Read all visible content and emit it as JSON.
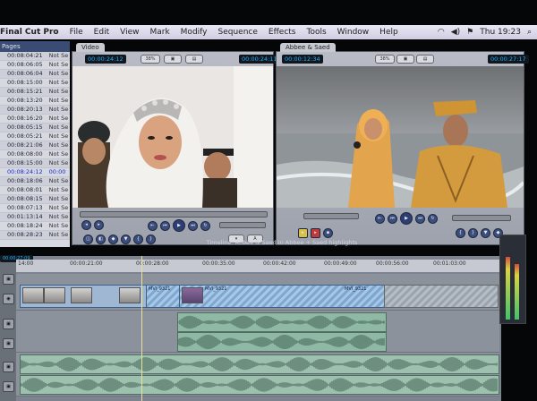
{
  "menubar": {
    "app": "Final Cut Pro",
    "items": [
      "File",
      "Edit",
      "View",
      "Mark",
      "Modify",
      "Sequence",
      "Effects",
      "Tools",
      "Window",
      "Help"
    ],
    "clock": "Thu 19:23"
  },
  "browser": {
    "header": "Pages",
    "rows": [
      {
        "tc": "00:08:04:21",
        "status": "Not Se"
      },
      {
        "tc": "00:08:06:05",
        "status": "Not Se"
      },
      {
        "tc": "00:08:06:04",
        "status": "Not Se"
      },
      {
        "tc": "00:08:15:00",
        "status": "Not Se"
      },
      {
        "tc": "00:08:15:21",
        "status": "Not Se"
      },
      {
        "tc": "00:08:13:20",
        "status": "Not Se"
      },
      {
        "tc": "00:08:20:13",
        "status": "Not Se"
      },
      {
        "tc": "00:08:16:20",
        "status": "Not Se"
      },
      {
        "tc": "00:08:05:15",
        "status": "Not Se"
      },
      {
        "tc": "00:08:05:21",
        "status": "Not Se"
      },
      {
        "tc": "00:08:21:06",
        "status": "Not Se"
      },
      {
        "tc": "00:08:08:00",
        "status": "Not Se"
      },
      {
        "tc": "00:08:15:00",
        "status": "Not Se"
      },
      {
        "tc": "00:08:24:12",
        "status": "00:00",
        "selected": true
      },
      {
        "tc": "00:08:18:06",
        "status": "Not Se"
      },
      {
        "tc": "00:08:08:01",
        "status": "Not Se"
      },
      {
        "tc": "00:08:08:15",
        "status": "Not Se"
      },
      {
        "tc": "00:08:07:13",
        "status": "Not Se"
      },
      {
        "tc": "00:01:13:14",
        "status": "Not Se"
      },
      {
        "tc": "00:08:18:24",
        "status": "Not Se"
      },
      {
        "tc": "00:08:28:23",
        "status": "Not Se"
      }
    ]
  },
  "viewer": {
    "tab": "Video",
    "tc_left": "00:00:24:12",
    "tc_right": "00:00:24:11",
    "zoom": "38%"
  },
  "canvas": {
    "tab": "Abbee & Saed",
    "tc_left": "00:00:12:34",
    "tc_right": "00:00:27:17",
    "zoom": "38%"
  },
  "timeline": {
    "title": "Timeline: Abbee & Saed in Abbee + Saed highlights",
    "current_tc": "00:00:27:09",
    "ruler": [
      "14:00",
      "00:00:21:00",
      "00:00:28:00",
      "00:00:35:00",
      "00:00:42:00",
      "00:00:49:00",
      "00:00:56:00",
      "00:01:03:00"
    ],
    "clips": {
      "v_a": "MVI_9321",
      "v_b": "MVI_9321",
      "v_c": "MVI_9321"
    },
    "playhead_fraction": 0.26
  },
  "colors": {
    "accent_timecode": "#20b3ff",
    "clip_video": "#a6c8e6",
    "clip_audio": "#8fb9a5"
  }
}
